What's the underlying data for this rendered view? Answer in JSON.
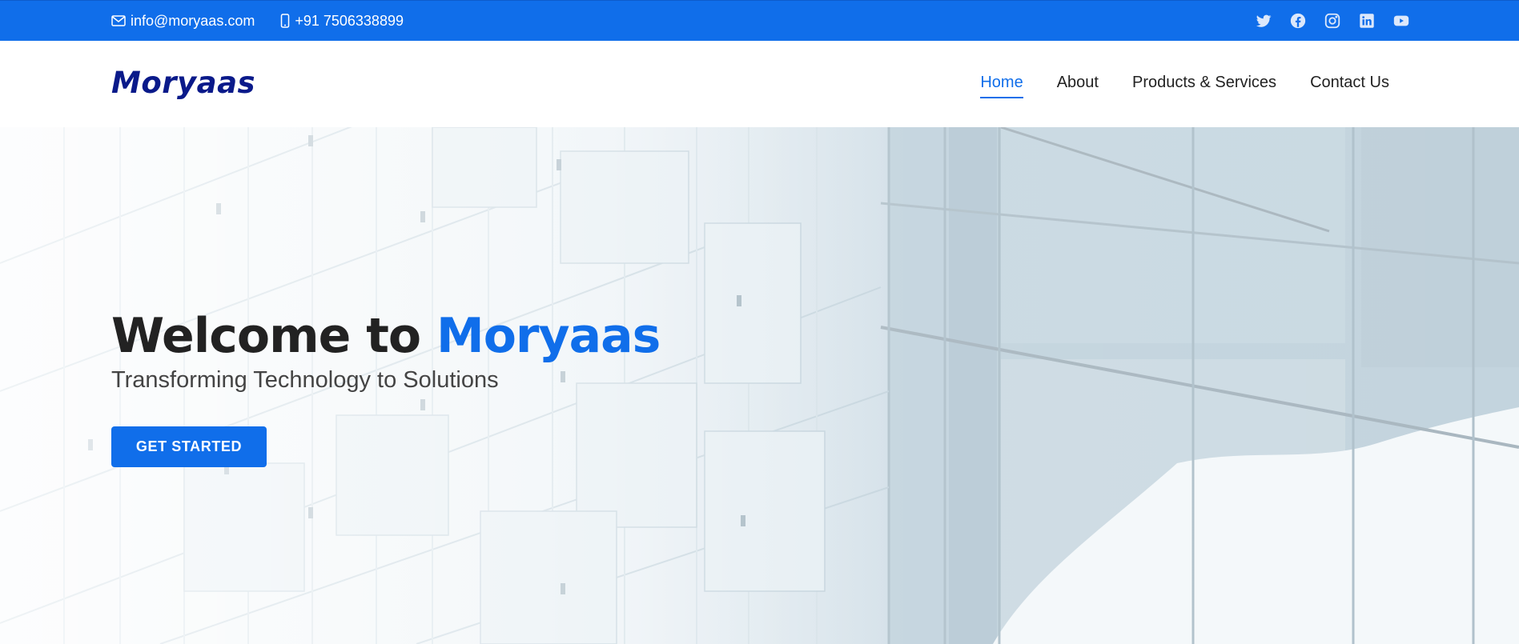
{
  "colors": {
    "accent": "#106eea",
    "logo": "#0a1a8a",
    "heading": "#222222",
    "subtitle": "#444444"
  },
  "topbar": {
    "email": {
      "icon": "envelope-icon",
      "text": "info@moryaas.com"
    },
    "phone": {
      "icon": "phone-icon",
      "text": "+91 7506338899"
    },
    "social": [
      {
        "name": "twitter-icon"
      },
      {
        "name": "facebook-icon"
      },
      {
        "name": "instagram-icon"
      },
      {
        "name": "linkedin-icon"
      },
      {
        "name": "youtube-icon"
      }
    ]
  },
  "header": {
    "logo": "Moryaas",
    "nav": [
      {
        "label": "Home",
        "active": true
      },
      {
        "label": "About",
        "active": false
      },
      {
        "label": "Products & Services",
        "active": false
      },
      {
        "label": "Contact Us",
        "active": false
      }
    ]
  },
  "hero": {
    "title_prefix": "Welcome to ",
    "title_brand": "Moryaas",
    "subtitle": "Transforming Technology to Solutions",
    "cta_label": "GET STARTED",
    "background": "glass-building-facade"
  }
}
